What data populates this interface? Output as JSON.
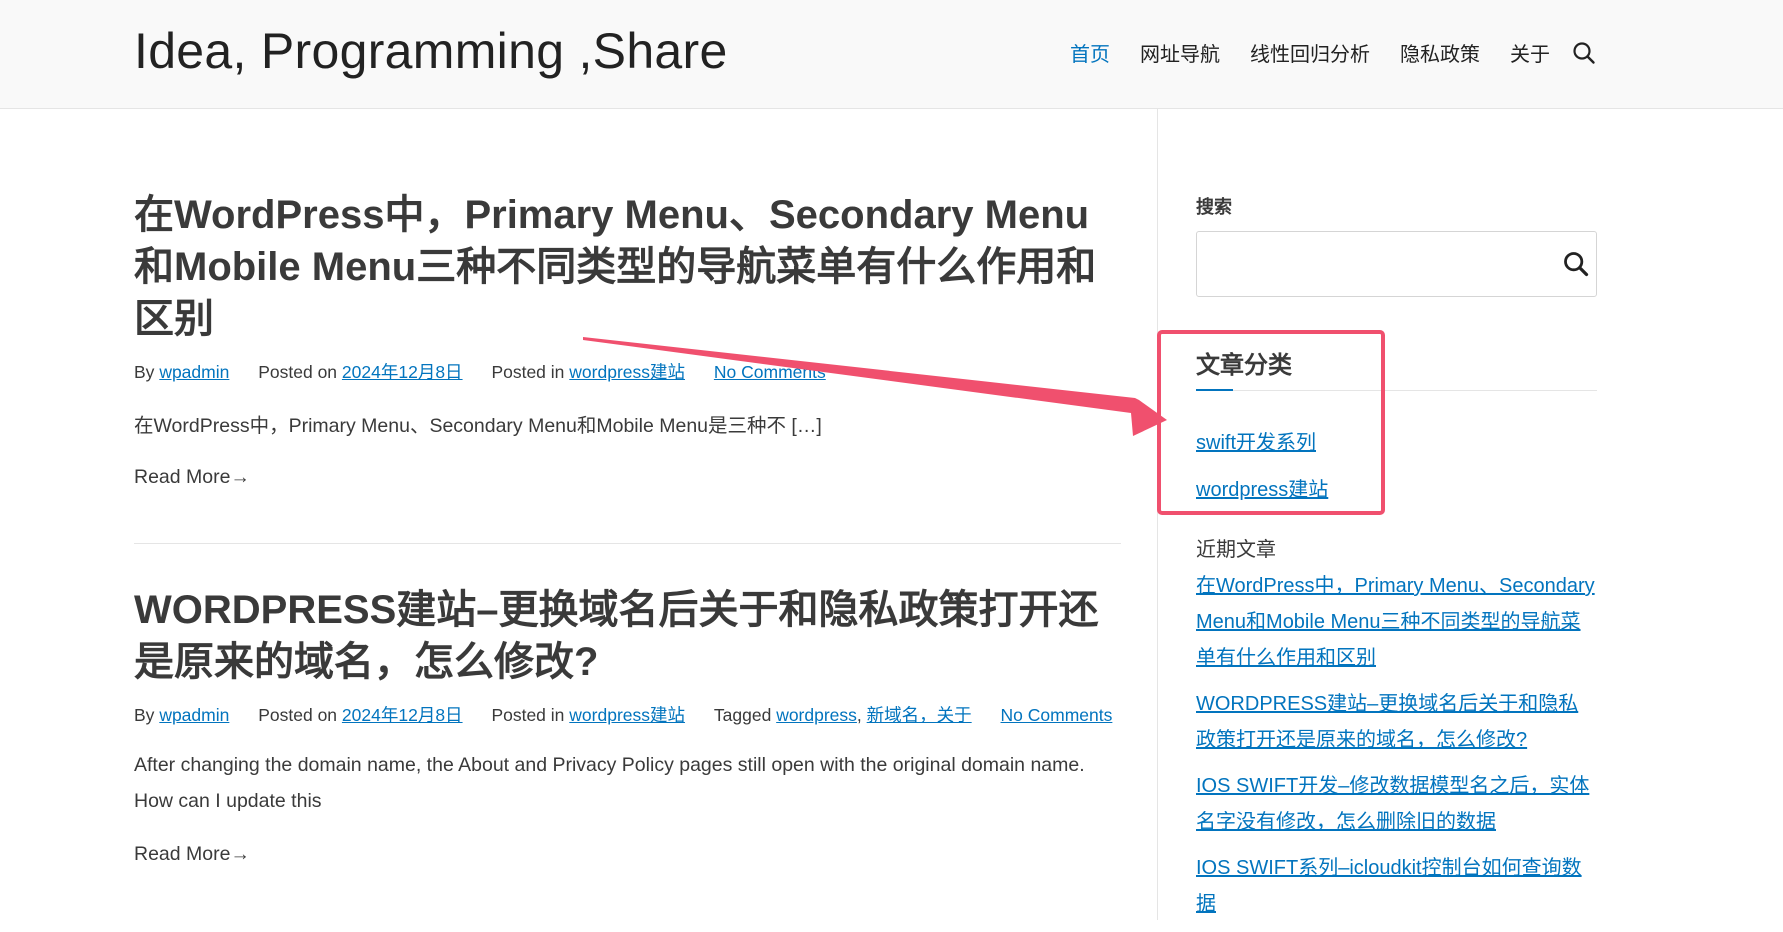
{
  "header": {
    "site_title": "Idea, Programming ,Share",
    "nav": [
      {
        "label": "首页",
        "active": true
      },
      {
        "label": "网址导航",
        "active": false
      },
      {
        "label": "线性回归分析",
        "active": false
      },
      {
        "label": "隐私政策",
        "active": false
      },
      {
        "label": "关于",
        "active": false
      }
    ],
    "search_icon": "search-icon"
  },
  "posts": [
    {
      "title": "在WordPress中，Primary Menu、Secondary Menu和Mobile Menu三种不同类型的导航菜单有什么作用和区别",
      "by_label": "By",
      "author": "wpadmin",
      "posted_on_label": "Posted on",
      "date": "2024年12月8日",
      "posted_in_label": "Posted in",
      "category": "wordpress建站",
      "comments": "No Comments",
      "excerpt": "在WordPress中，Primary Menu、Secondary Menu和Mobile Menu是三种不 […]",
      "read_more": "Read More"
    },
    {
      "title": "WORDPRESS建站–更换域名后关于和隐私政策打开还是原来的域名，怎么修改?",
      "by_label": "By",
      "author": "wpadmin",
      "posted_on_label": "Posted on",
      "date": "2024年12月8日",
      "posted_in_label": "Posted in",
      "category": "wordpress建站",
      "tagged_label": "Tagged",
      "tags": [
        "wordpress",
        "新域名，关于"
      ],
      "comments": "No Comments",
      "excerpt": "After changing the domain name, the About and Privacy Policy pages still open with the original domain name. How can I update this",
      "read_more": "Read More"
    }
  ],
  "sidebar": {
    "search_label": "搜索",
    "search_placeholder": "",
    "categories_title": "文章分类",
    "categories": [
      "swift开发系列",
      "wordpress建站"
    ],
    "recent_title": "近期文章",
    "recent_posts": [
      "在WordPress中，Primary Menu、Secondary Menu和Mobile Menu三种不同类型的导航菜单有什么作用和区别",
      "WORDPRESS建站–更换域名后关于和隐私政策打开还是原来的域名，怎么修改?",
      "IOS SWIFT开发–修改数据模型名之后，实体名字没有修改，怎么删除旧的数据",
      "IOS SWIFT系列–icloudkit控制台如何查询数据"
    ]
  },
  "colors": {
    "link": "#0274be",
    "annotation": "#f0506e"
  }
}
